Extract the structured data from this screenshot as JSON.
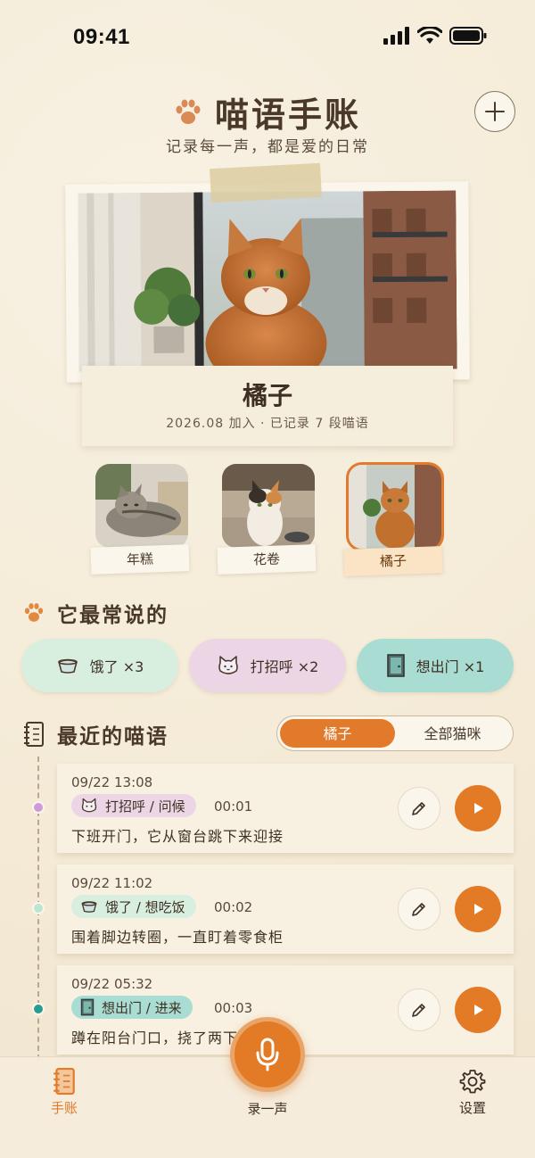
{
  "status": {
    "time": "09:41"
  },
  "header": {
    "title": "喵语手账",
    "subtitle": "记录每一声，都是爱的日常",
    "add_label": "+"
  },
  "profile": {
    "name": "橘子",
    "meta": "2026.08 加入 · 已记录 7 段喵语"
  },
  "cats": [
    {
      "name": "年糕",
      "active": false
    },
    {
      "name": "花卷",
      "active": false
    },
    {
      "name": "橘子",
      "active": true
    }
  ],
  "frequent": {
    "heading": "它最常说的",
    "pills": [
      {
        "label": "饿了 ×3",
        "icon": "bowl-icon",
        "color": "#d8eedf"
      },
      {
        "label": "打招呼 ×2",
        "icon": "cat-face-icon",
        "color": "#ecd6e6"
      },
      {
        "label": "想出门 ×1",
        "icon": "door-icon",
        "color": "#a9ddd3"
      }
    ]
  },
  "recent": {
    "heading": "最近的喵语",
    "toggle": {
      "active": "橘子",
      "all": "全部猫咪"
    },
    "entries": [
      {
        "time": "09/22 13:08",
        "tag": "打招呼 / 问候",
        "duration": "00:01",
        "desc": "下班开门，它从窗台跳下来迎接",
        "dot_color": "#cf9ad8",
        "tag_color": "#ecd6e6",
        "icon": "cat-face-icon"
      },
      {
        "time": "09/22 11:02",
        "tag": "饿了 / 想吃饭",
        "duration": "00:02",
        "desc": "围着脚边转圈，一直盯着零食柜",
        "dot_color": "#bde6d0",
        "tag_color": "#d8eedf",
        "icon": "bowl-icon"
      },
      {
        "time": "09/22 05:32",
        "tag": "想出门 / 进来",
        "duration": "00:03",
        "desc": "蹲在阳台门口，挠了两下门",
        "dot_color": "#2a9c92",
        "tag_color": "#a9ddd3",
        "icon": "door-icon"
      }
    ]
  },
  "tabbar": {
    "journal": "手账",
    "record": "录一声",
    "settings": "设置"
  },
  "colors": {
    "accent": "#e27a26",
    "background": "#f6eedd"
  }
}
